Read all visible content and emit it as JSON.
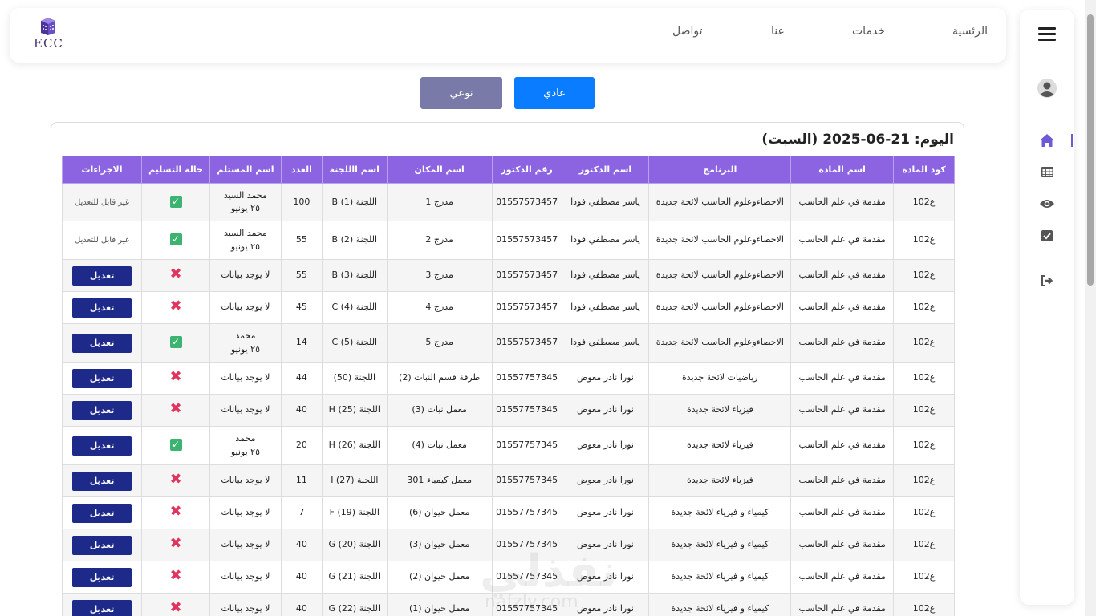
{
  "logo": {
    "text": "ECC"
  },
  "nav": {
    "home": "الرئسية",
    "services": "خدمات",
    "about": "عنا",
    "contact": "تواصل"
  },
  "buttons": {
    "special": "نوعي",
    "regular": "عادي"
  },
  "day": {
    "title": "اليوم: 21-06-2025 (السبت)"
  },
  "table": {
    "headers": [
      "كود المادة",
      "اسم المادة",
      "البرنامج",
      "اسم الدكتور",
      "رقم الدكتور",
      "اسم المكان",
      "اسم االلجنة",
      "العدد",
      "اسم المستلم",
      "حالة التسليم",
      "الاجراءات"
    ],
    "rows": [
      {
        "code": "ع102",
        "subject": "مقدمة في علم الحاسب",
        "program": "الاحصاءوعلوم الحاسب لائحة جديدة",
        "doctor": "ياسر مصطفي فودا",
        "phone": "01557573457",
        "place": "مدرج 1",
        "committee": "اللجنة (1) B",
        "count": "100",
        "receiver": "محمد السيد",
        "receiver_date": "٢٥ يونيو",
        "delivered": true,
        "action": "غير قابل للتعديل",
        "editable": false
      },
      {
        "code": "ع102",
        "subject": "مقدمة في علم الحاسب",
        "program": "الاحصاءوعلوم الحاسب لائحة جديدة",
        "doctor": "ياسر مصطفي فودا",
        "phone": "01557573457",
        "place": "مدرج 2",
        "committee": "اللجنة (2) B",
        "count": "55",
        "receiver": "محمد السيد",
        "receiver_date": "٢٥ يونيو",
        "delivered": true,
        "action": "غير قابل للتعديل",
        "editable": false
      },
      {
        "code": "ع102",
        "subject": "مقدمة في علم الحاسب",
        "program": "الاحصاءوعلوم الحاسب لائحة جديدة",
        "doctor": "ياسر مصطفي فودا",
        "phone": "01557573457",
        "place": "مدرج 3",
        "committee": "اللجنة (3) B",
        "count": "55",
        "receiver": "لا يوجد بيانات",
        "receiver_date": "",
        "delivered": false,
        "action": "تعديل",
        "editable": true
      },
      {
        "code": "ع102",
        "subject": "مقدمة في علم الحاسب",
        "program": "الاحصاءوعلوم الحاسب لائحة جديدة",
        "doctor": "ياسر مصطفي فودا",
        "phone": "01557573457",
        "place": "مدرج 4",
        "committee": "اللجنة (4) C",
        "count": "45",
        "receiver": "لا يوجد بيانات",
        "receiver_date": "",
        "delivered": false,
        "action": "تعديل",
        "editable": true
      },
      {
        "code": "ع102",
        "subject": "مقدمة في علم الحاسب",
        "program": "الاحصاءوعلوم الحاسب لائحة جديدة",
        "doctor": "ياسر مصطفي فودا",
        "phone": "01557573457",
        "place": "مدرج 5",
        "committee": "اللجنة (5) C",
        "count": "14",
        "receiver": "محمد",
        "receiver_date": "٢٥ يونيو",
        "delivered": true,
        "action": "تعديل",
        "editable": true
      },
      {
        "code": "ع102",
        "subject": "مقدمة في علم الحاسب",
        "program": "رياضيات لائحة جديدة",
        "doctor": "نورا نادر معوض",
        "phone": "01557757345",
        "place": "طرقة قسم النبات (2)",
        "committee": "اللجنة (50)",
        "count": "44",
        "receiver": "لا يوجد بيانات",
        "receiver_date": "",
        "delivered": false,
        "action": "تعديل",
        "editable": true
      },
      {
        "code": "ع102",
        "subject": "مقدمة في علم الحاسب",
        "program": "فيزياء لائحة جديدة",
        "doctor": "نورا نادر معوض",
        "phone": "01557757345",
        "place": "معمل نبات (3)",
        "committee": "اللجنة (25) H",
        "count": "40",
        "receiver": "لا يوجد بيانات",
        "receiver_date": "",
        "delivered": false,
        "action": "تعديل",
        "editable": true
      },
      {
        "code": "ع102",
        "subject": "مقدمة في علم الحاسب",
        "program": "فيزياء لائحة جديدة",
        "doctor": "نورا نادر معوض",
        "phone": "01557757345",
        "place": "معمل نبات (4)",
        "committee": "اللجنة (26) H",
        "count": "20",
        "receiver": "محمد",
        "receiver_date": "٢٥ يونيو",
        "delivered": true,
        "action": "تعديل",
        "editable": true
      },
      {
        "code": "ع102",
        "subject": "مقدمة في علم الحاسب",
        "program": "فيزياء لائحة جديدة",
        "doctor": "نورا نادر معوض",
        "phone": "01557757345",
        "place": "معمل كيمياء 301",
        "committee": "اللجنة (27) I",
        "count": "11",
        "receiver": "لا يوجد بيانات",
        "receiver_date": "",
        "delivered": false,
        "action": "تعديل",
        "editable": true
      },
      {
        "code": "ع102",
        "subject": "مقدمة في علم الحاسب",
        "program": "كيمياء و فيزياء لائحة جديدة",
        "doctor": "نورا نادر معوض",
        "phone": "01557757345",
        "place": "معمل حيوان (6)",
        "committee": "اللجنة (19) F",
        "count": "7",
        "receiver": "لا يوجد بيانات",
        "receiver_date": "",
        "delivered": false,
        "action": "تعديل",
        "editable": true
      },
      {
        "code": "ع102",
        "subject": "مقدمة في علم الحاسب",
        "program": "كيمياء و فيزياء لائحة جديدة",
        "doctor": "نورا نادر معوض",
        "phone": "01557757345",
        "place": "معمل حيوان (3)",
        "committee": "اللجنة (20) G",
        "count": "40",
        "receiver": "لا يوجد بيانات",
        "receiver_date": "",
        "delivered": false,
        "action": "تعديل",
        "editable": true
      },
      {
        "code": "ع102",
        "subject": "مقدمة في علم الحاسب",
        "program": "كيمياء و فيزياء لائحة جديدة",
        "doctor": "نورا نادر معوض",
        "phone": "01557757345",
        "place": "معمل حيوان (2)",
        "committee": "اللجنة (21) G",
        "count": "40",
        "receiver": "لا يوجد بيانات",
        "receiver_date": "",
        "delivered": false,
        "action": "تعديل",
        "editable": true
      },
      {
        "code": "ع102",
        "subject": "مقدمة في علم الحاسب",
        "program": "كيمياء و فيزياء لائحة جديدة",
        "doctor": "نورا نادر معوض",
        "phone": "01557757345",
        "place": "معمل حيوان (1)",
        "committee": "اللجنة (22) G",
        "count": "40",
        "receiver": "لا يوجد بيانات",
        "receiver_date": "",
        "delivered": false,
        "action": "تعديل",
        "editable": true
      }
    ]
  },
  "watermark": {
    "text": "نفذلي",
    "sub": "nafzly.com"
  },
  "colors": {
    "header_bg": "#8c63e0",
    "edit_button": "#1e2a8a",
    "regular_button": "#0a7cff",
    "special_button": "#7a7aa8",
    "delivered": "#3cb371",
    "not_delivered": "#e0335d"
  },
  "icons": {
    "sidebar": [
      "menu-icon",
      "user-avatar-icon",
      "home-icon",
      "table-icon",
      "eye-icon",
      "checkbox-icon",
      "logout-icon"
    ]
  }
}
